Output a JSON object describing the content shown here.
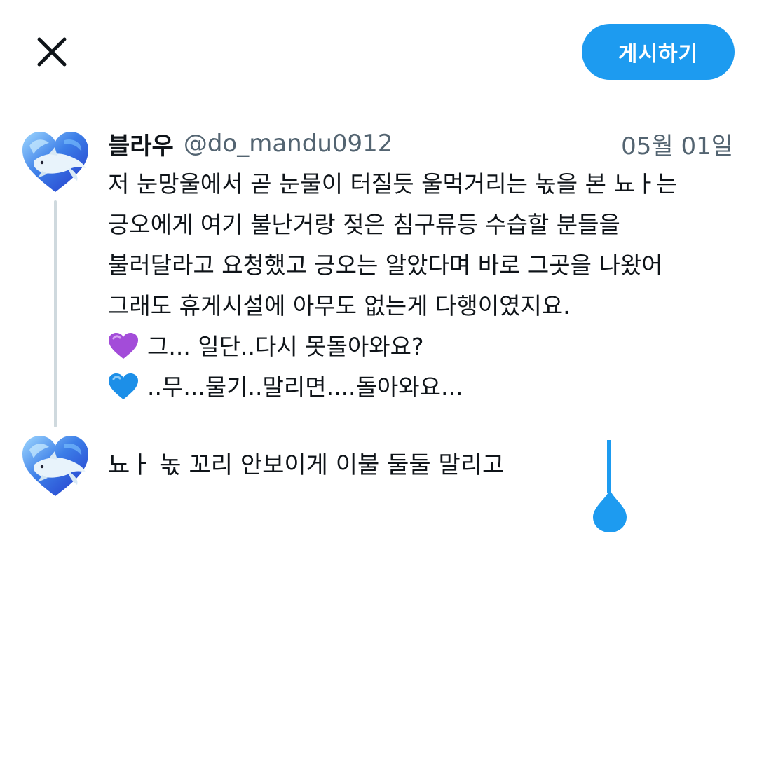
{
  "header": {
    "close_icon": "close-icon",
    "post_button_label": "게시하기",
    "accent_color": "#1d9bf0"
  },
  "quoted_tweet": {
    "display_name": "블라우",
    "handle": "@do_mandu0912",
    "timestamp": "05월 01일",
    "avatar_icon": "dolphin-heart-avatar",
    "lines": [
      "저 눈망울에서 곧 눈물이 터질듯 울먹거리는 녻을 본 뇨ㅏ는",
      "긍오에게 여기 불난거랑 젖은 침구류등 수습할 분들을",
      "불러달라고 요청했고 긍오는 알았다며 바로 그곳을 나왔어",
      "그래도 휴게시설에 아무도 없는게 다행이였지요."
    ],
    "dialogue": [
      {
        "icon": "purple-heart-icon",
        "color": "#a34cd9",
        "text": "그... 일단..다시 못돌아와요?"
      },
      {
        "icon": "blue-heart-icon",
        "color": "#1c8fe8",
        "text": "..무...물기..말리면....돌아와요..."
      }
    ]
  },
  "reply": {
    "avatar_icon": "dolphin-heart-avatar",
    "text": "뇨ㅏ 녻 꼬리 안보이게 이불 둘둘 말리고"
  }
}
